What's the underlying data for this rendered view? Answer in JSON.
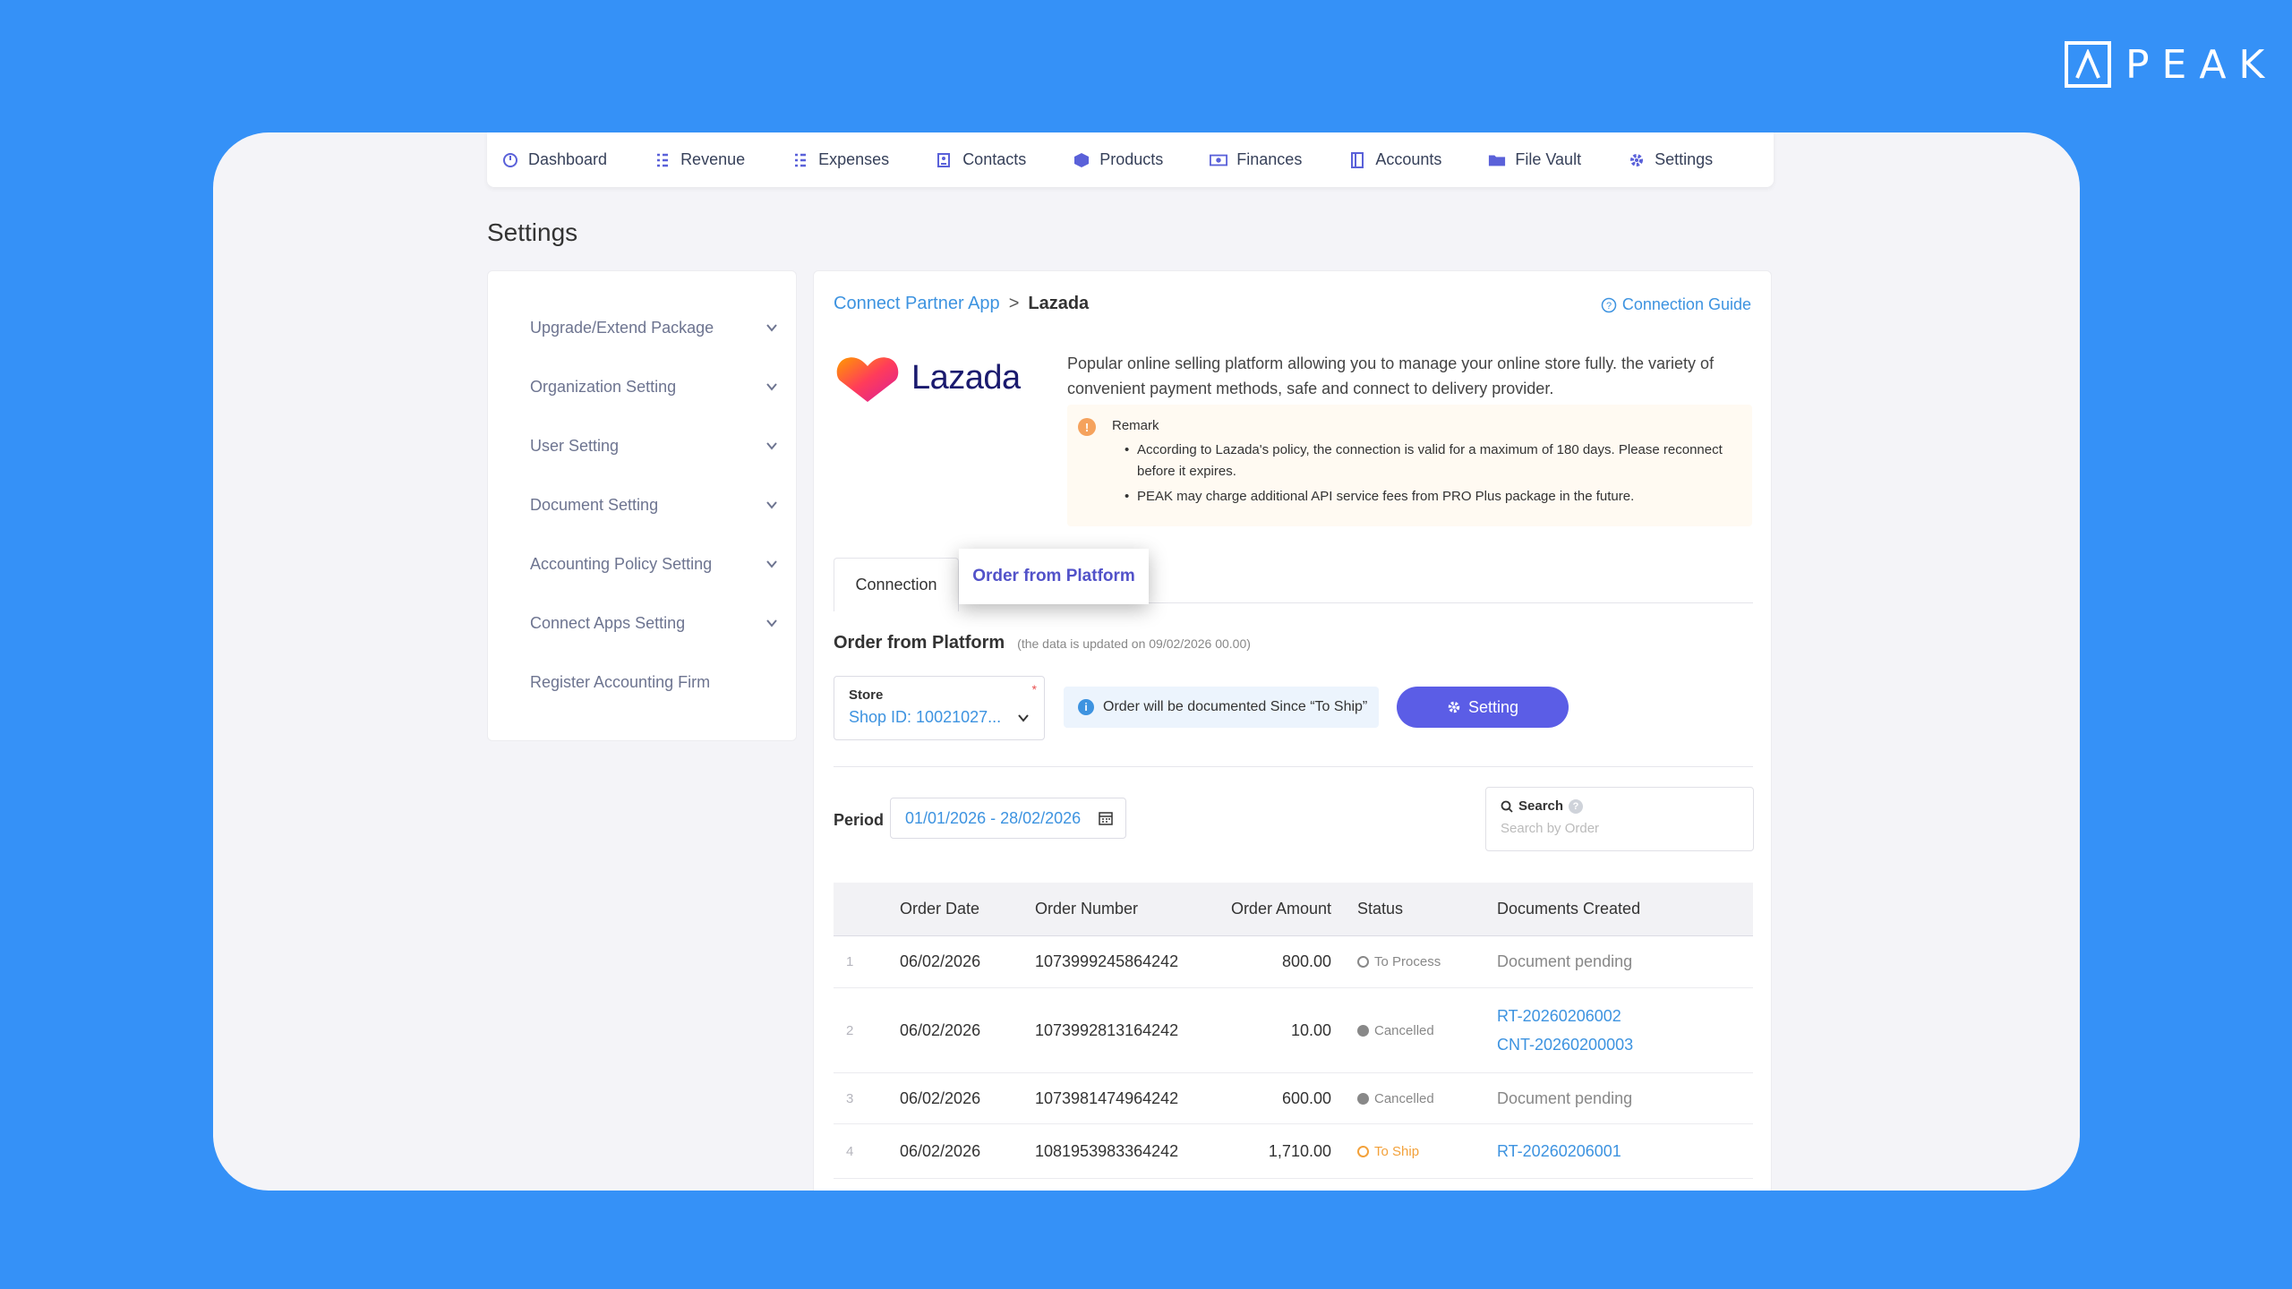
{
  "brand": {
    "logo_text": "PEAK"
  },
  "nav": {
    "items": [
      {
        "label": "Dashboard",
        "icon": "dashboard-icon"
      },
      {
        "label": "Revenue",
        "icon": "revenue-icon"
      },
      {
        "label": "Expenses",
        "icon": "expenses-icon"
      },
      {
        "label": "Contacts",
        "icon": "contacts-icon"
      },
      {
        "label": "Products",
        "icon": "products-icon"
      },
      {
        "label": "Finances",
        "icon": "finances-icon"
      },
      {
        "label": "Accounts",
        "icon": "accounts-icon"
      },
      {
        "label": "File Vault",
        "icon": "folder-icon"
      },
      {
        "label": "Settings",
        "icon": "gear-icon"
      }
    ]
  },
  "page_title": "Settings",
  "sidebar": {
    "items": [
      {
        "label": "Upgrade/Extend Package"
      },
      {
        "label": "Organization Setting"
      },
      {
        "label": "User Setting"
      },
      {
        "label": "Document Setting"
      },
      {
        "label": "Accounting Policy Setting"
      },
      {
        "label": "Connect Apps Setting"
      },
      {
        "label": "Register Accounting Firm"
      }
    ]
  },
  "breadcrumb": {
    "parent": "Connect Partner App",
    "separator": ">",
    "current": "Lazada"
  },
  "guide_label": "Connection Guide",
  "partner": {
    "logo_text": "Lazada",
    "description": "Popular online selling platform allowing you to manage your online store fully. the variety of convenient payment methods, safe and connect to delivery provider."
  },
  "remark": {
    "title": "Remark",
    "bullets": [
      "According to Lazada's policy, the connection is valid for a maximum of 180 days. Please reconnect before it expires.",
      "PEAK may charge additional API service fees from PRO Plus package in the future."
    ]
  },
  "tabs": {
    "connection": "Connection",
    "order": "Order from Platform"
  },
  "section": {
    "title": "Order from Platform",
    "subtitle": "(the data is updated on 09/02/2026 00.00)"
  },
  "store": {
    "label": "Store",
    "required_mark": "*",
    "value": "Shop ID: 10021027..."
  },
  "info_note": "Order will be documented Since “To Ship”",
  "setting_button": "Setting",
  "period": {
    "label": "Period",
    "value": "01/01/2026 - 28/02/2026"
  },
  "search": {
    "label": "Search",
    "placeholder": "Search by Order"
  },
  "table": {
    "headers": [
      "Order Date",
      "Order Number",
      "Order Amount",
      "Status",
      "Documents Created"
    ],
    "rows": [
      {
        "no": "1",
        "date": "06/02/2026",
        "number": "1073999245864242",
        "amount": "800.00",
        "status": "To Process",
        "docs": [
          "Document pending"
        ]
      },
      {
        "no": "2",
        "date": "06/02/2026",
        "number": "1073992813164242",
        "amount": "10.00",
        "status": "Cancelled",
        "docs": [
          "RT-20260206002",
          "CNT-20260200003"
        ]
      },
      {
        "no": "3",
        "date": "06/02/2026",
        "number": "1073981474964242",
        "amount": "600.00",
        "status": "Cancelled",
        "docs": [
          "Document pending"
        ]
      },
      {
        "no": "4",
        "date": "06/02/2026",
        "number": "1081953983364242",
        "amount": "1,710.00",
        "status": "To Ship",
        "docs": [
          "RT-20260206001"
        ]
      }
    ]
  },
  "colors": {
    "background": "#3591f7",
    "accent": "#5b5de6",
    "link": "#3d93e0",
    "to_ship": "#f3a13a"
  }
}
